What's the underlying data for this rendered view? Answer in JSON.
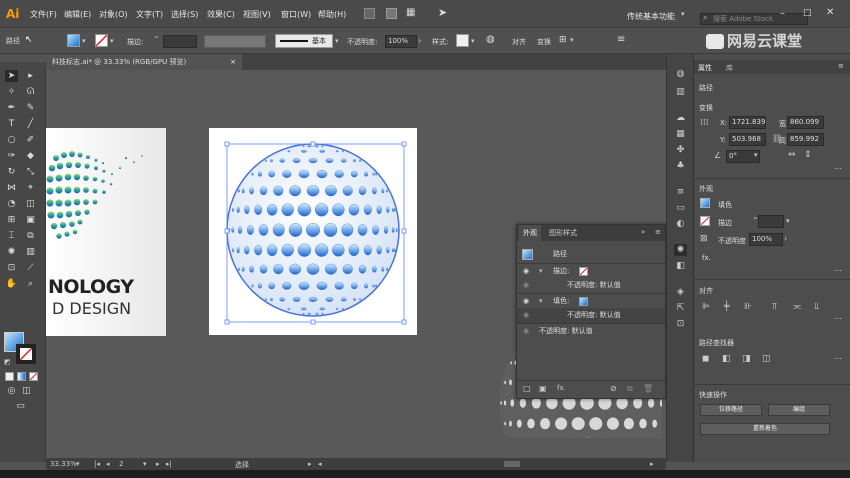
{
  "app": {
    "logo": "Ai",
    "workspace": "传统基本功能",
    "search_placeholder": "搜索 Adobe Stock",
    "watermark": "网易云课堂"
  },
  "menus": [
    "文件(F)",
    "编辑(E)",
    "对象(O)",
    "文字(T)",
    "选择(S)",
    "效果(C)",
    "视图(V)",
    "窗口(W)",
    "帮助(H)"
  ],
  "control": {
    "selection_label": "路径",
    "stroke_label": "描边:",
    "stroke_value": "",
    "style_preset": "基本",
    "opacity_label": "不透明度:",
    "opacity_value": "100%",
    "style_label": "样式:",
    "align_label": "对齐",
    "transform_label": "变换"
  },
  "document": {
    "tab_title": "科技标志.ai* @ 33.33% (RGB/GPU 预览)",
    "close": "×"
  },
  "artwork": {
    "line1": "NOLOGY",
    "line2": "D DESIGN"
  },
  "appearance_panel": {
    "tabs": [
      "外观",
      "图形样式"
    ],
    "header": "路径",
    "rows": [
      {
        "label": "描边:",
        "value": ""
      },
      {
        "label": "不透明度: 默认值"
      },
      {
        "label": "填色:",
        "value": ""
      },
      {
        "label": "不透明度: 默认值"
      },
      {
        "label": "不透明度: 默认值"
      }
    ],
    "footer_fx": "fx."
  },
  "status": {
    "zoom": "33.33%",
    "artboard": "2",
    "tool": "选择"
  },
  "properties": {
    "tabs": [
      "属性",
      "库"
    ],
    "selection": "路径",
    "transform_title": "变换",
    "x_label": "X:",
    "x": "1721.839",
    "y_label": "Y:",
    "y": "503.968",
    "w_label": "宽:",
    "w": "860.099",
    "h_label": "高:",
    "h": "859.992",
    "angle": "0°",
    "appearance_title": "外观",
    "fill_label": "填色",
    "stroke_label": "描边",
    "opacity_label": "不透明度",
    "opacity": "100%",
    "fx": "fx.",
    "align_title": "对齐",
    "pathfinder_title": "路径查找器",
    "quick_actions_title": "快速操作",
    "btn_offset": "位移路径",
    "btn_group": "编组",
    "btn_recolor": "重新着色"
  },
  "colors": {
    "accent": "#3a7bd5",
    "panel": "#4d4d4d",
    "canvas": "#595959"
  }
}
